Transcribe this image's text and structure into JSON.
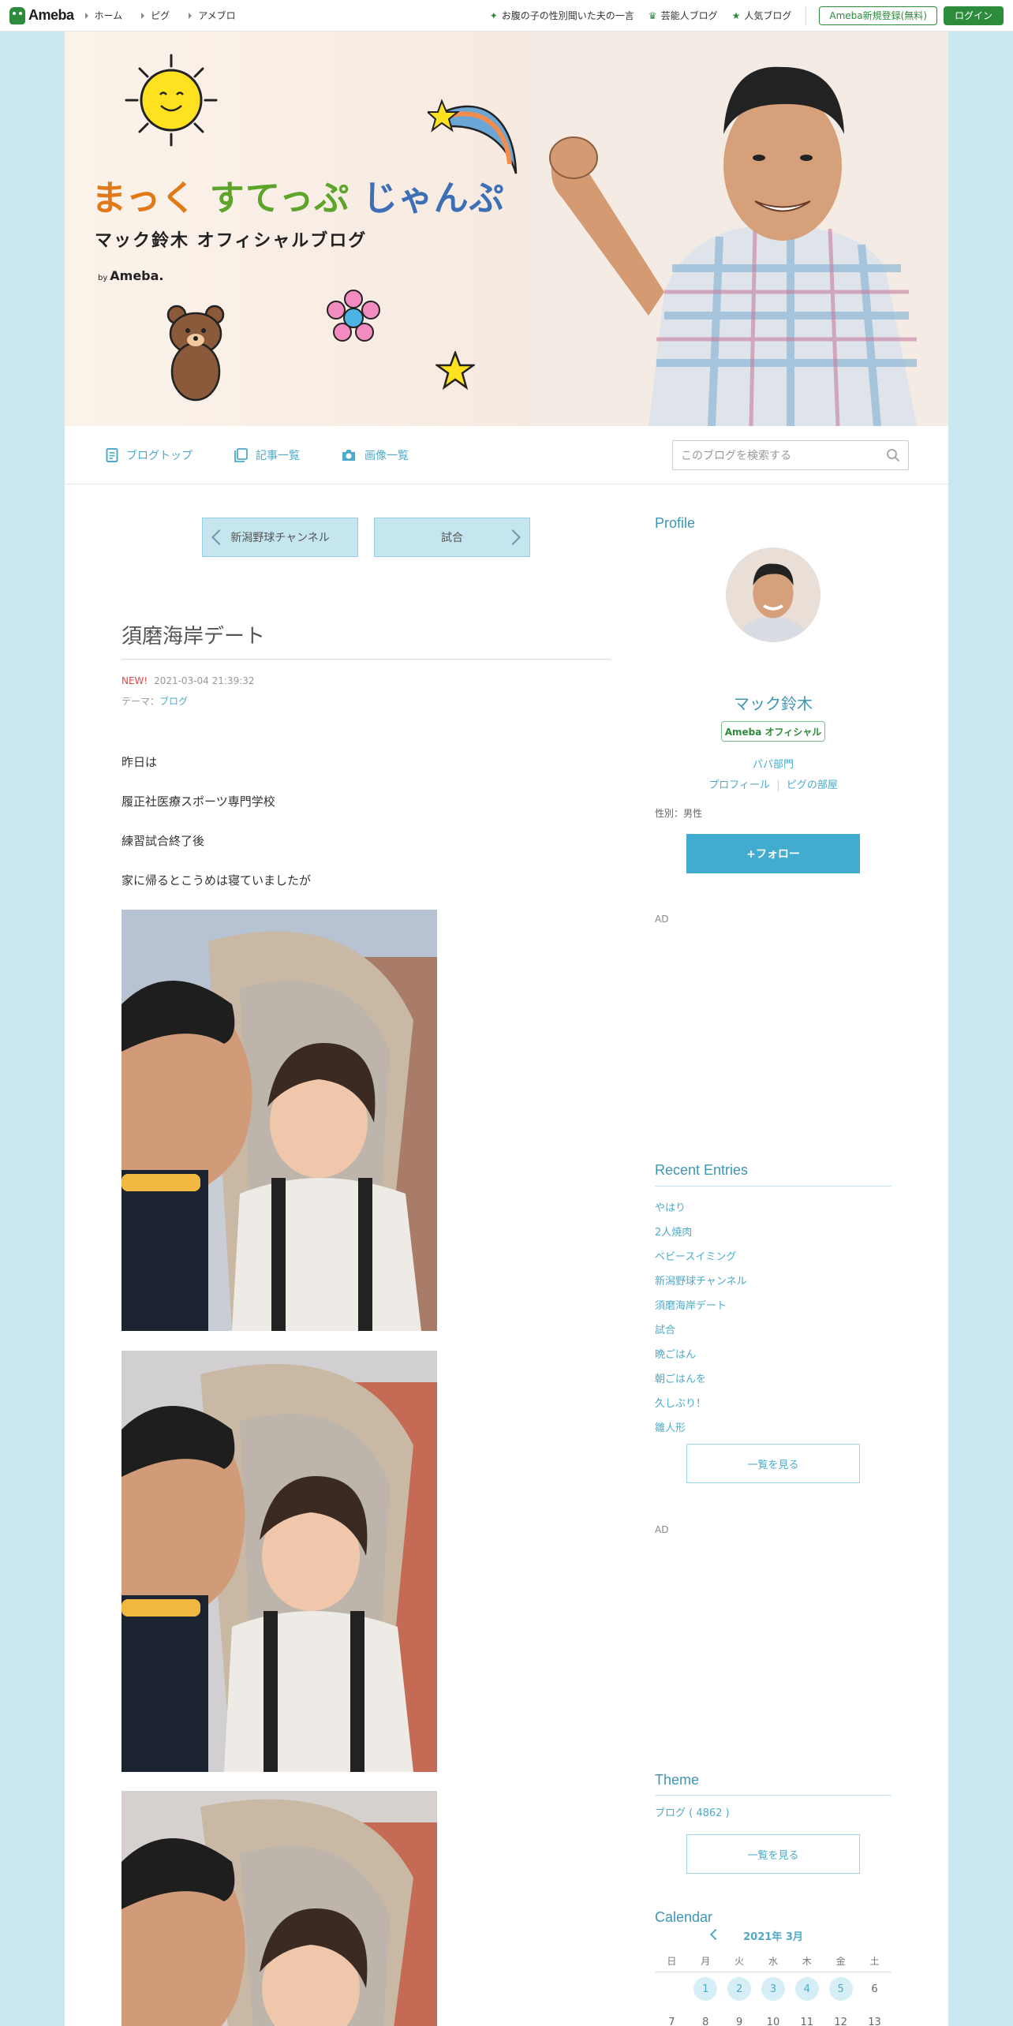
{
  "global_header": {
    "logo_text": "Ameba",
    "nav": [
      "ホーム",
      "ピグ",
      "アメブロ"
    ],
    "right_items": [
      {
        "label": "お腹の子の性別聞いた夫の一言",
        "icon": "sparkle-icon"
      },
      {
        "label": "芸能人ブログ",
        "icon": "crown-icon"
      },
      {
        "label": "人気ブログ",
        "icon": "star-icon"
      }
    ],
    "register_label": "Ameba新規登録(無料)",
    "login_label": "ログイン"
  },
  "banner": {
    "title_part1": "まっく",
    "title_part2": "すてっぷ",
    "title_part3": "じゃんぷ",
    "subtitle": "マック鈴木 オフィシャルブログ",
    "by_prefix": "by",
    "by_brand": "Ameba."
  },
  "blog_nav": {
    "items": [
      {
        "label": "ブログトップ",
        "icon": "document-icon"
      },
      {
        "label": "記事一覧",
        "icon": "copy-icon"
      },
      {
        "label": "画像一覧",
        "icon": "camera-icon"
      }
    ],
    "search_placeholder": "このブログを検索する"
  },
  "article": {
    "prev_label": "新潟野球チャンネル",
    "next_label": "試合",
    "title": "須磨海岸デート",
    "new_badge": "NEW!",
    "datetime": "2021-03-04 21:39:32",
    "theme_prefix": "テーマ：",
    "theme_link": "ブログ",
    "paragraphs": [
      "昨日は",
      "履正社医療スポーツ専門学校",
      "練習試合終了後",
      "家に帰るとこうめは寝ていましたが"
    ]
  },
  "sidebar": {
    "profile_heading": "Profile",
    "profile_name": "マック鈴木",
    "official_badge": "Ameba オフィシャル",
    "category": "パパ部門",
    "profile_link": "プロフィール",
    "pig_link": "ピグの部屋",
    "gender": "性別：男性",
    "follow_label": "+フォロー",
    "ad_label": "AD",
    "recent_heading": "Recent Entries",
    "recent_entries": [
      "やはり",
      "2人焼肉",
      "ベビースイミング",
      "新潟野球チャンネル",
      "須磨海岸デート",
      "試合",
      "晩ごはん",
      "朝ごはんを",
      "久しぶり！",
      "雛人形"
    ],
    "see_all_label": "一覧を見る",
    "theme_heading": "Theme",
    "theme_item": "ブログ ( 4862 )",
    "calendar_heading": "Calendar",
    "calendar_month": "2021年 3月",
    "weekdays": [
      "日",
      "月",
      "火",
      "水",
      "木",
      "金",
      "土"
    ],
    "week1": [
      "",
      "1",
      "2",
      "3",
      "4",
      "5",
      "6"
    ],
    "week2": [
      "7",
      "8",
      "9",
      "10",
      "11",
      "12",
      "13"
    ]
  },
  "colors": {
    "background": "#cbe7f0",
    "accent": "#41abd0",
    "link": "#4dabc9",
    "ameba_green": "#2d8c3c",
    "new_red": "#e04545"
  }
}
